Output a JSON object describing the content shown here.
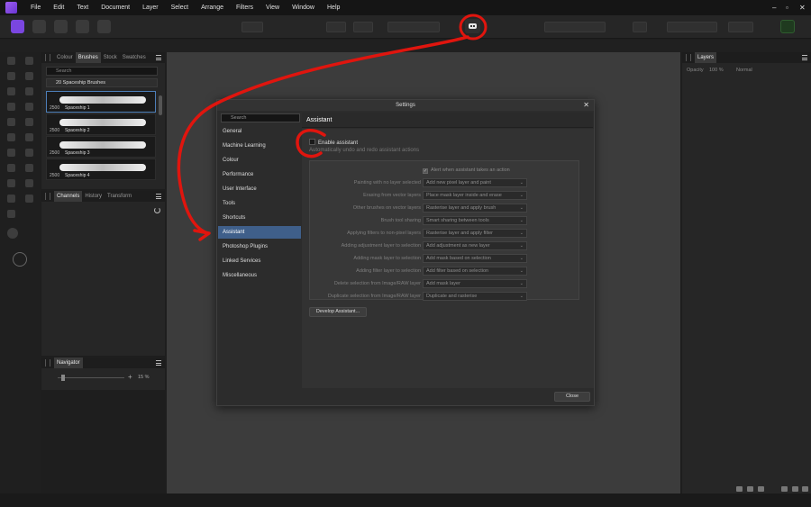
{
  "menubar": {
    "items": [
      "File",
      "Edit",
      "Text",
      "Document",
      "Layer",
      "Select",
      "Arrange",
      "Filters",
      "View",
      "Window",
      "Help"
    ],
    "min": "–",
    "max": "▫",
    "close": "✕"
  },
  "brushes_panel": {
    "tabs": [
      "Colour",
      "Brushes",
      "Stock",
      "Swatches"
    ],
    "search_placeholder": "Search",
    "category": "20 Spaceship Brushes",
    "brushes": [
      {
        "size": "2500",
        "name": "Spaceship 1"
      },
      {
        "size": "2500",
        "name": "Spaceship 2"
      },
      {
        "size": "2500",
        "name": "Spaceship 3"
      },
      {
        "size": "2500",
        "name": "Spaceship 4"
      }
    ]
  },
  "channels_panel": {
    "tabs": [
      "Channels",
      "History",
      "Transform"
    ]
  },
  "navigator_panel": {
    "tabs": [
      "Navigator"
    ],
    "zoom": "15 %"
  },
  "layers_panel": {
    "tabs": [
      "Layers"
    ],
    "opacity_label": "Opacity",
    "opacity_value": "100 %",
    "blend_mode": "Normal"
  },
  "settings": {
    "title": "Settings",
    "close_glyph": "✕",
    "search_placeholder": "Search",
    "categories": [
      "General",
      "Machine Learning",
      "Colour",
      "Performance",
      "User Interface",
      "Tools",
      "Shortcuts",
      "Assistant",
      "Photoshop Plugins",
      "Linked Services",
      "Miscellaneous"
    ],
    "active_category": "Assistant",
    "section_title": "Assistant",
    "enable_assistant": "Enable assistant",
    "auto_undo": "Automatically undo and redo assistant actions",
    "alert_label": "Alert when assistant takes an action",
    "options": [
      {
        "label": "Painting with no layer selected",
        "value": "Add new pixel layer and paint"
      },
      {
        "label": "Erasing from vector layers",
        "value": "Place mask layer inside and erase"
      },
      {
        "label": "Other brushes on vector layers",
        "value": "Rasterise layer and apply brush"
      },
      {
        "label": "Brush tool sharing",
        "value": "Smart sharing between tools"
      },
      {
        "label": "Applying filters to non-pixel layers",
        "value": "Rasterise layer and apply filter"
      },
      {
        "label": "Adding adjustment layer to selection",
        "value": "Add adjustment as new layer"
      },
      {
        "label": "Adding mask layer to selection",
        "value": "Add mask based on selection"
      },
      {
        "label": "Adding filter layer to selection",
        "value": "Add filter based on selection"
      },
      {
        "label": "Delete selection from Image/RAW layer",
        "value": "Add mask layer"
      },
      {
        "label": "Duplicate selection from Image/RAW layer",
        "value": "Duplicate and rasterise"
      }
    ],
    "develop_button": "Develop Assistant...",
    "close_button": "Close"
  },
  "colors": {
    "accent": "#3f5f8a",
    "annotation": "#e0150e"
  }
}
